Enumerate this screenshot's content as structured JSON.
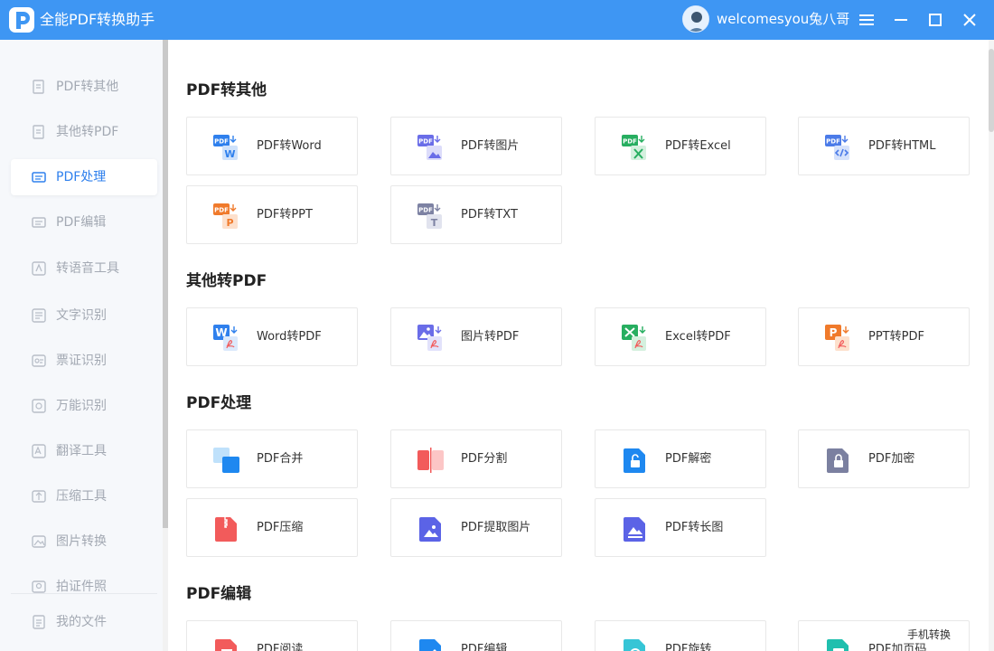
{
  "app": {
    "title": "全能PDF转换助手",
    "username": "welcomesyou兔八哥"
  },
  "sidebar": {
    "items": [
      {
        "label": "PDF转其他"
      },
      {
        "label": "其他转PDF"
      },
      {
        "label": "PDF处理"
      },
      {
        "label": "PDF编辑"
      },
      {
        "label": "转语音工具"
      },
      {
        "label": "文字识别"
      },
      {
        "label": "票证识别"
      },
      {
        "label": "万能识别"
      },
      {
        "label": "翻译工具"
      },
      {
        "label": "压缩工具"
      },
      {
        "label": "图片转换"
      },
      {
        "label": "拍证件照"
      }
    ],
    "my_files": "我的文件"
  },
  "sections": {
    "pdf_to_other": {
      "title": "PDF转其他",
      "cards": [
        "PDF转Word",
        "PDF转图片",
        "PDF转Excel",
        "PDF转HTML",
        "PDF转PPT",
        "PDF转TXT"
      ]
    },
    "other_to_pdf": {
      "title": "其他转PDF",
      "cards": [
        "Word转PDF",
        "图片转PDF",
        "Excel转PDF",
        "PPT转PDF"
      ]
    },
    "pdf_process": {
      "title": "PDF处理",
      "cards": [
        "PDF合并",
        "PDF分割",
        "PDF解密",
        "PDF加密",
        "PDF压缩",
        "PDF提取图片",
        "PDF转长图"
      ]
    },
    "pdf_edit": {
      "title": "PDF编辑",
      "cards": [
        "PDF阅读",
        "PDF编辑",
        "PDF旋转",
        "PDF加页码"
      ]
    }
  },
  "floating": {
    "mobile_switch": "手机转换"
  },
  "icon_badge_text": "PDF",
  "colors": {
    "titlebar": "#3e96f3",
    "active": "#2f80ed",
    "word": "#2f80ed",
    "image": "#6a6de8",
    "excel": "#27ae60",
    "html": "#4b7be8",
    "ppt": "#f07a2b",
    "txt": "#7d82a3",
    "red": "#f25b5b",
    "lock_blue": "#1e88f0",
    "lock_gray": "#7b80a0"
  },
  "icons": [
    "pdf-to-word-icon",
    "pdf-to-image-icon",
    "pdf-to-excel-icon",
    "pdf-to-html-icon",
    "pdf-to-ppt-icon",
    "pdf-to-txt-icon",
    "word-to-pdf-icon",
    "image-to-pdf-icon",
    "excel-to-pdf-icon",
    "ppt-to-pdf-icon",
    "merge-icon",
    "split-icon",
    "unlock-icon",
    "lock-icon",
    "compress-icon",
    "extract-image-icon",
    "long-image-icon",
    "read-icon",
    "edit-icon",
    "rotate-icon",
    "page-number-icon"
  ]
}
